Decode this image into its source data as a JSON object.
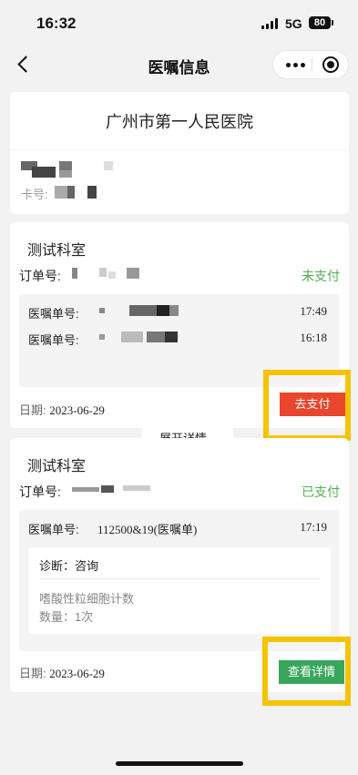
{
  "status_bar": {
    "time": "16:32",
    "network": "5G",
    "battery": "80"
  },
  "nav": {
    "title": "医嘱信息"
  },
  "hospital": {
    "name": "广州市第一人民医院",
    "card_no_label": "卡号:"
  },
  "orders": [
    {
      "department": "测试科室",
      "order_no_label": "订单号:",
      "status": "未支付",
      "prescriptions": [
        {
          "label": "医嘱单号:",
          "time": "17:49"
        },
        {
          "label": "医嘱单号:",
          "time": "16:18"
        }
      ],
      "expand_label": "展开详情",
      "date_label": "日期:",
      "date": "2023-06-29",
      "action_label": "去支付"
    },
    {
      "department": "测试科室",
      "order_no_label": "订单号:",
      "status": "已支付",
      "prescription": {
        "label": "医嘱单号:",
        "number": "112500&19(医嘱单)",
        "time": "17:19"
      },
      "diagnosis": "诊断：咨询",
      "exam_name": "嗜酸性粒细胞计数",
      "exam_qty": "数量：1次",
      "date_label": "日期:",
      "date": "2023-06-29",
      "action_label": "查看详情"
    }
  ],
  "colors": {
    "paid_green": "#4cb34c",
    "pay_button": "#e8472d",
    "view_button": "#3aa65c",
    "highlight": "#f5c300"
  }
}
